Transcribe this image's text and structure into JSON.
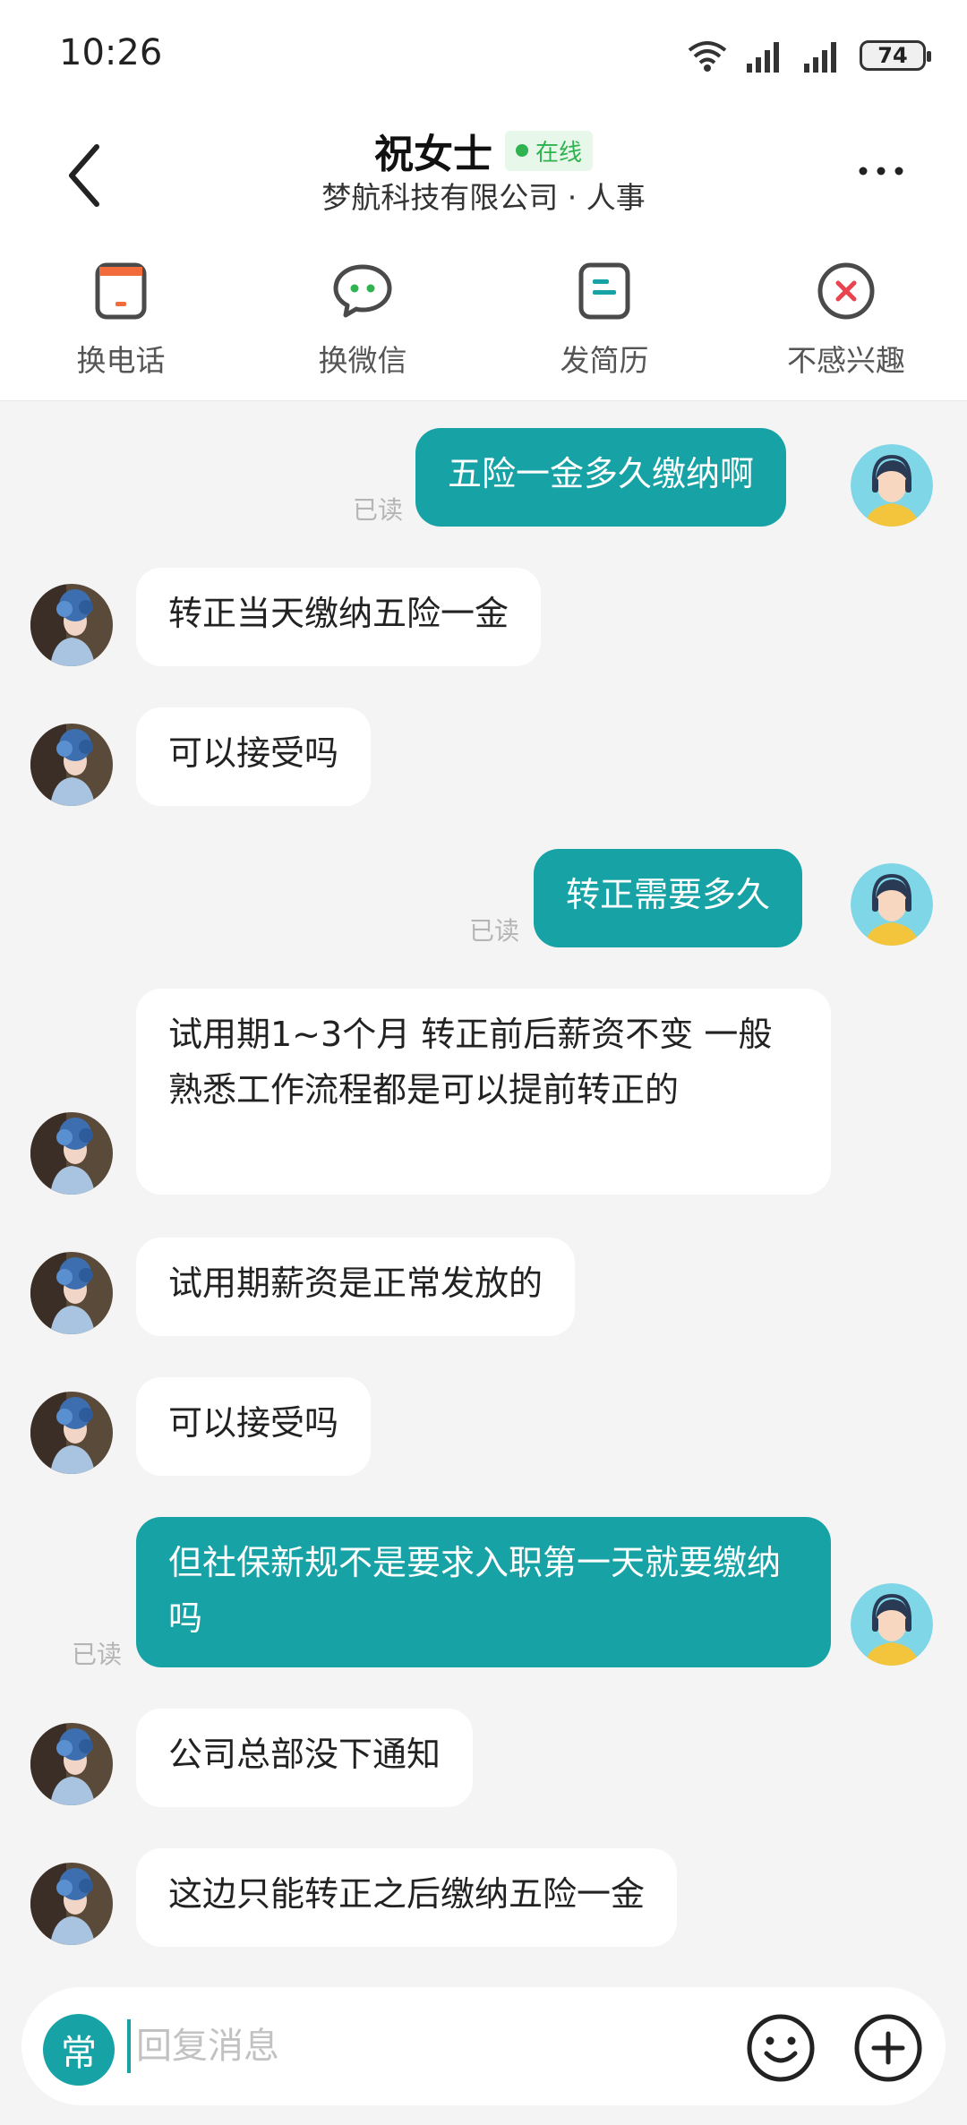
{
  "status_bar": {
    "time": "10:26",
    "battery": "74"
  },
  "header": {
    "title": "祝女士",
    "online_badge": "在线",
    "subtitle": "梦航科技有限公司 · 人事"
  },
  "actions": [
    {
      "label": "换电话",
      "icon": "phone-card-icon"
    },
    {
      "label": "换微信",
      "icon": "wechat-icon"
    },
    {
      "label": "发简历",
      "icon": "resume-icon"
    },
    {
      "label": "不感兴趣",
      "icon": "not-interested-icon"
    }
  ],
  "messages": [
    {
      "dir": "out",
      "text": "五险一金多久缴纳啊",
      "read": "已读"
    },
    {
      "dir": "in",
      "text": "转正当天缴纳五险一金"
    },
    {
      "dir": "in",
      "text": "可以接受吗"
    },
    {
      "dir": "out",
      "text": "转正需要多久",
      "read": "已读"
    },
    {
      "dir": "in",
      "text": "试用期1~3个月 转正前后薪资不变 一般熟悉工作流程都是可以提前转正的"
    },
    {
      "dir": "in",
      "text": "试用期薪资是正常发放的"
    },
    {
      "dir": "in",
      "text": "可以接受吗"
    },
    {
      "dir": "out",
      "text": "但社保新规不是要求入职第一天就要缴纳吗",
      "read": "已读"
    },
    {
      "dir": "in",
      "text": "公司总部没下通知"
    },
    {
      "dir": "in",
      "text": "这边只能转正之后缴纳五险一金"
    }
  ],
  "input_bar": {
    "quick_phrase_label": "常",
    "placeholder": "回复消息"
  },
  "colors": {
    "accent": "#17a2a5",
    "online": "#2fb34f",
    "background": "#f4f4f4"
  }
}
